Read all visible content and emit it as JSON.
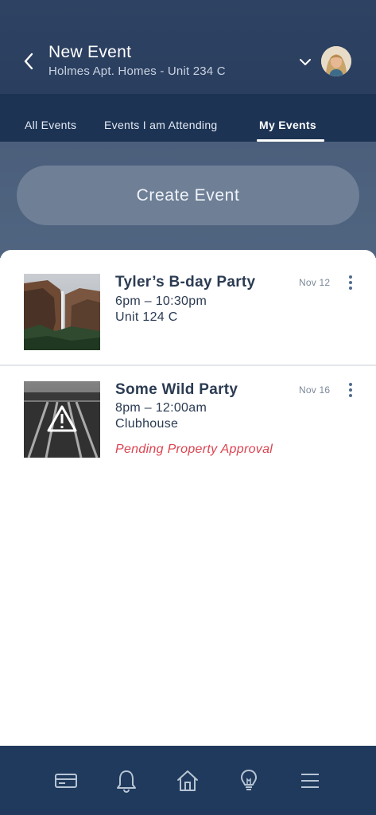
{
  "header": {
    "title": "New Event",
    "subtitle": "Holmes Apt. Homes - Unit 234 C"
  },
  "tabs": [
    {
      "label": "All Events",
      "active": false
    },
    {
      "label": "Events I am Attending",
      "active": false
    },
    {
      "label": "My Events",
      "active": true
    }
  ],
  "create_button": {
    "label": "Create Event"
  },
  "events": [
    {
      "title": "Tyler’s B-day Party",
      "time": "6pm – 10:30pm",
      "location": "Unit 124 C",
      "date": "Nov 12",
      "image": "waterfall-photo"
    },
    {
      "title": "Some Wild Party",
      "time": "8pm – 12:00am",
      "location": "Clubhouse",
      "date": "Nov 16",
      "status": "Pending Property Approval",
      "image": "railroad-photo-with-warning"
    }
  ],
  "bottom_nav": {
    "items": [
      {
        "icon": "card-icon"
      },
      {
        "icon": "bell-icon"
      },
      {
        "icon": "home-icon"
      },
      {
        "icon": "lightbulb-icon"
      },
      {
        "icon": "menu-icon"
      }
    ]
  },
  "colors": {
    "header_bg": "#2e4263",
    "tabs_bg": "#1c3354",
    "create_area_bg": "#4b5f7c",
    "create_button_bg": "#6e7f96",
    "status_red": "#dc4450",
    "nav_bg": "#1f3a5c"
  }
}
